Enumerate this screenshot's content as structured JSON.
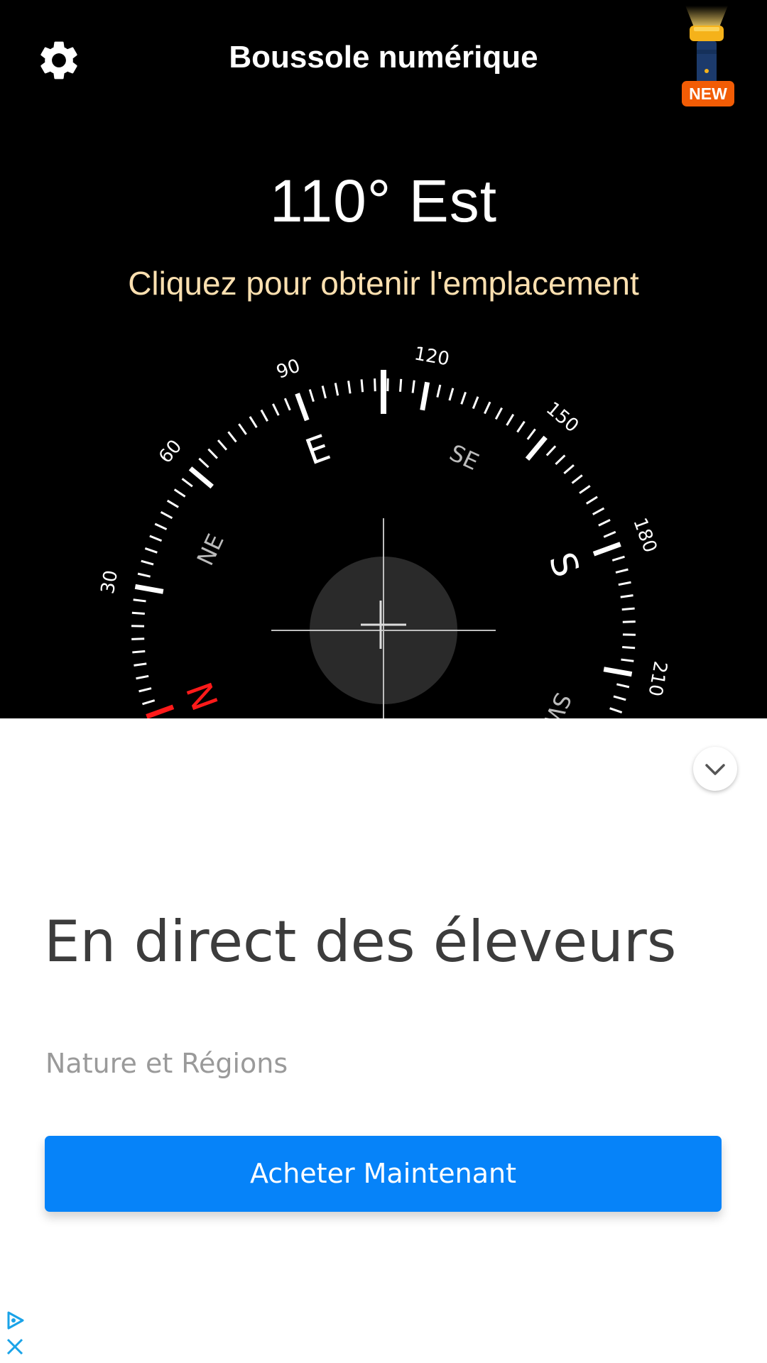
{
  "header": {
    "title": "Boussole numérique",
    "new_badge": "NEW",
    "settings_icon": "gear-icon",
    "flashlight_icon": "flashlight-icon"
  },
  "reading": {
    "heading_text": "110° Est",
    "location_link": "Cliquez pour obtenir l'emplacement"
  },
  "compass": {
    "heading_degrees": 110,
    "degree_labels": [
      "30",
      "60",
      "90",
      "120",
      "150",
      "180",
      "210"
    ],
    "cardinal_labels": {
      "E": "E",
      "S": "S",
      "N": "N"
    },
    "intercardinal_labels": {
      "NE": "NE",
      "SE": "SE",
      "SW": "SW"
    },
    "north_color": "#ff1a1a",
    "tick_color": "#ffffff",
    "center_disc_color": "#2a2a2a"
  },
  "ad": {
    "headline": "En direct des éleveurs",
    "advertiser": "Nature et Régions",
    "cta_label": "Acheter Maintenant",
    "cta_color": "#0683f9",
    "collapse_icon": "chevron-down-icon",
    "adchoices_icon": "adchoices-icon",
    "close_icon": "close-icon"
  }
}
